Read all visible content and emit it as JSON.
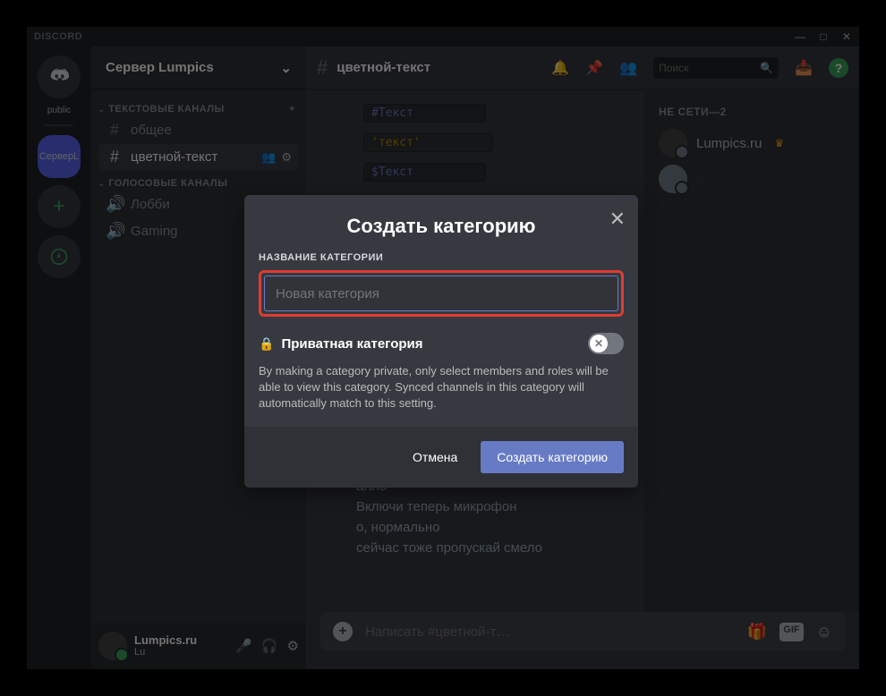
{
  "app_name": "DISCORD",
  "window_controls": {
    "minimize": "—",
    "maximize": "□",
    "close": "✕"
  },
  "guilds": {
    "public_label": "public",
    "server_initials": "СерверL"
  },
  "server": {
    "name": "Сервер Lumpics"
  },
  "categories": [
    {
      "name": "ТЕКСТОВЫЕ КАНАЛЫ",
      "channels": [
        {
          "type": "text",
          "label": "общее",
          "selected": false
        },
        {
          "type": "text",
          "label": "цветной-текст",
          "selected": true
        }
      ]
    },
    {
      "name": "ГОЛОСОВЫЕ КАНАЛЫ",
      "channels": [
        {
          "type": "voice",
          "label": "Лобби"
        },
        {
          "type": "voice",
          "label": "Gaming"
        }
      ]
    }
  ],
  "user": {
    "name": "Lumpics.ru",
    "sub": "Lu"
  },
  "header": {
    "channel_name": "цветной-текст",
    "search_placeholder": "Поиск"
  },
  "messages": [
    {
      "style": "code blue",
      "text": "#Текст"
    },
    {
      "style": "code yellow",
      "text": "'текст'"
    },
    {
      "style": "code blue",
      "text": "$Текст"
    },
    {
      "style": "plain",
      "text": "алло"
    },
    {
      "style": "plain",
      "text": "Включи теперь микрофон"
    },
    {
      "style": "plain",
      "text": "о, нормально"
    },
    {
      "style": "plain",
      "text": "сейчас тоже пропускай смело"
    }
  ],
  "composer": {
    "placeholder": "Написать #цветной-т…"
  },
  "members": {
    "header": "НЕ СЕТИ—2",
    "list": [
      {
        "name": "Lumpics.ru",
        "owner": true
      },
      {
        "name": "V…",
        "owner": false
      }
    ]
  },
  "modal": {
    "title": "Создать категорию",
    "field_label": "НАЗВАНИЕ КАТЕГОРИИ",
    "input_placeholder": "Новая категория",
    "private_label": "Приватная категория",
    "private_desc": "By making a category private, only select members and roles will be able to view this category. Synced channels in this category will automatically match to this setting.",
    "cancel": "Отмена",
    "create": "Создать категорию"
  }
}
